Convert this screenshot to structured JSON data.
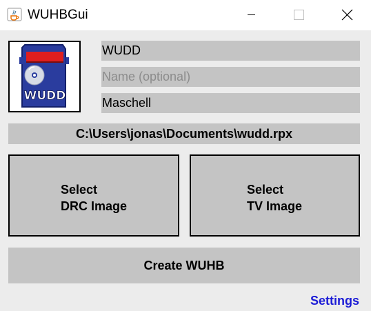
{
  "window": {
    "title": "WUHBGui",
    "minimize_icon": "minimize-icon",
    "maximize_icon": "maximize-icon",
    "close_icon": "close-icon"
  },
  "logo": {
    "icon": "sd-card-icon",
    "text": "WUDD"
  },
  "fields": {
    "title_value": "WUDD",
    "name_placeholder": "Name (optional)",
    "name_value": "",
    "author_value": "Maschell"
  },
  "path": "C:\\Users\\jonas\\Documents\\wudd.rpx",
  "drc_button": {
    "line1": "Select",
    "line2": "DRC Image"
  },
  "tv_button": {
    "line1": "Select",
    "line2": "TV Image"
  },
  "create_button": "Create WUHB",
  "settings_link": "Settings",
  "colors": {
    "field_bg": "#c4c4c4",
    "window_bg": "#ececec",
    "link": "#1b1bd6"
  }
}
